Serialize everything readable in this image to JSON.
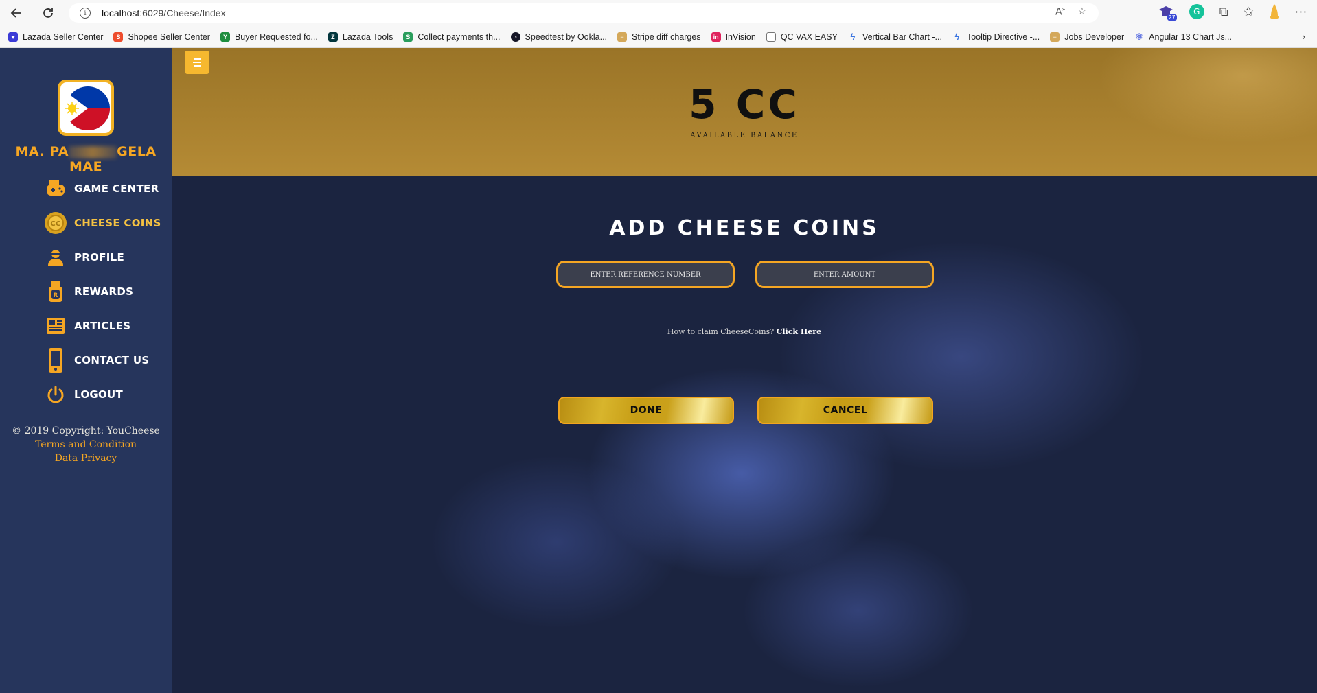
{
  "browser": {
    "url_host": "localhost",
    "url_rest": ":6029/Cheese/Index",
    "extension_badge": "27",
    "bookmarks": [
      {
        "label": "Lazada Seller Center",
        "icon": "lazada-icon",
        "color": "#3b3bd6"
      },
      {
        "label": "Shopee Seller Center",
        "icon": "shopee-icon",
        "color": "#ee4d2d"
      },
      {
        "label": "Buyer Requested fo...",
        "icon": "sheet-icon",
        "color": "#1e8e3e"
      },
      {
        "label": "Lazada Tools",
        "icon": "zendesk-icon",
        "color": "#03363d"
      },
      {
        "label": "Collect payments th...",
        "icon": "s-icon",
        "color": "#2a9d5c"
      },
      {
        "label": "Speedtest by Ookla...",
        "icon": "speedtest-icon",
        "color": "#141526"
      },
      {
        "label": "Stripe diff charges",
        "icon": "stripe-icon",
        "color": "#d4a85a"
      },
      {
        "label": "InVision",
        "icon": "invision-icon",
        "color": "#e0245e"
      },
      {
        "label": "QC VAX EASY",
        "icon": "doc-icon",
        "color": "#777777"
      },
      {
        "label": "Vertical Bar Chart -...",
        "icon": "bolt-icon",
        "color": "#3a74e0"
      },
      {
        "label": "Tooltip Directive -...",
        "icon": "bolt-icon",
        "color": "#3a74e0"
      },
      {
        "label": "Jobs Developer",
        "icon": "jobs-icon",
        "color": "#d4a85a"
      },
      {
        "label": "Angular 13 Chart Js...",
        "icon": "react-icon",
        "color": "#5a6ee0"
      }
    ]
  },
  "sidebar": {
    "user_name_start": "MA. PA",
    "user_name_end": "GELA MAE",
    "menu": [
      {
        "label": "GAME CENTER",
        "icon": "gamepad-icon"
      },
      {
        "label": "CHEESE COINS",
        "icon": "coin-icon"
      },
      {
        "label": "PROFILE",
        "icon": "user-icon"
      },
      {
        "label": "REWARDS",
        "icon": "medal-icon"
      },
      {
        "label": "ARTICLES",
        "icon": "newspaper-icon"
      },
      {
        "label": "CONTACT US",
        "icon": "phone-icon"
      },
      {
        "label": "LOGOUT",
        "icon": "power-icon"
      }
    ],
    "copyright": "© 2019 Copyright: YouCheese",
    "terms": "Terms and Condition",
    "privacy": "Data Privacy"
  },
  "balance": {
    "value": "5 CC",
    "label": "AVAILABLE BALANCE"
  },
  "form": {
    "title": "ADD CHEESE COINS",
    "ref_placeholder": "ENTER REFERENCE NUMBER",
    "amount_placeholder": "ENTER AMOUNT",
    "claim_text": "How to claim CheeseCoins?",
    "claim_link": "Click Here",
    "done_label": "DONE",
    "cancel_label": "CANCEL"
  },
  "colors": {
    "accent": "#f5a623",
    "sidebar_bg": "#26355c",
    "banner_gold": "#a57d2d"
  }
}
